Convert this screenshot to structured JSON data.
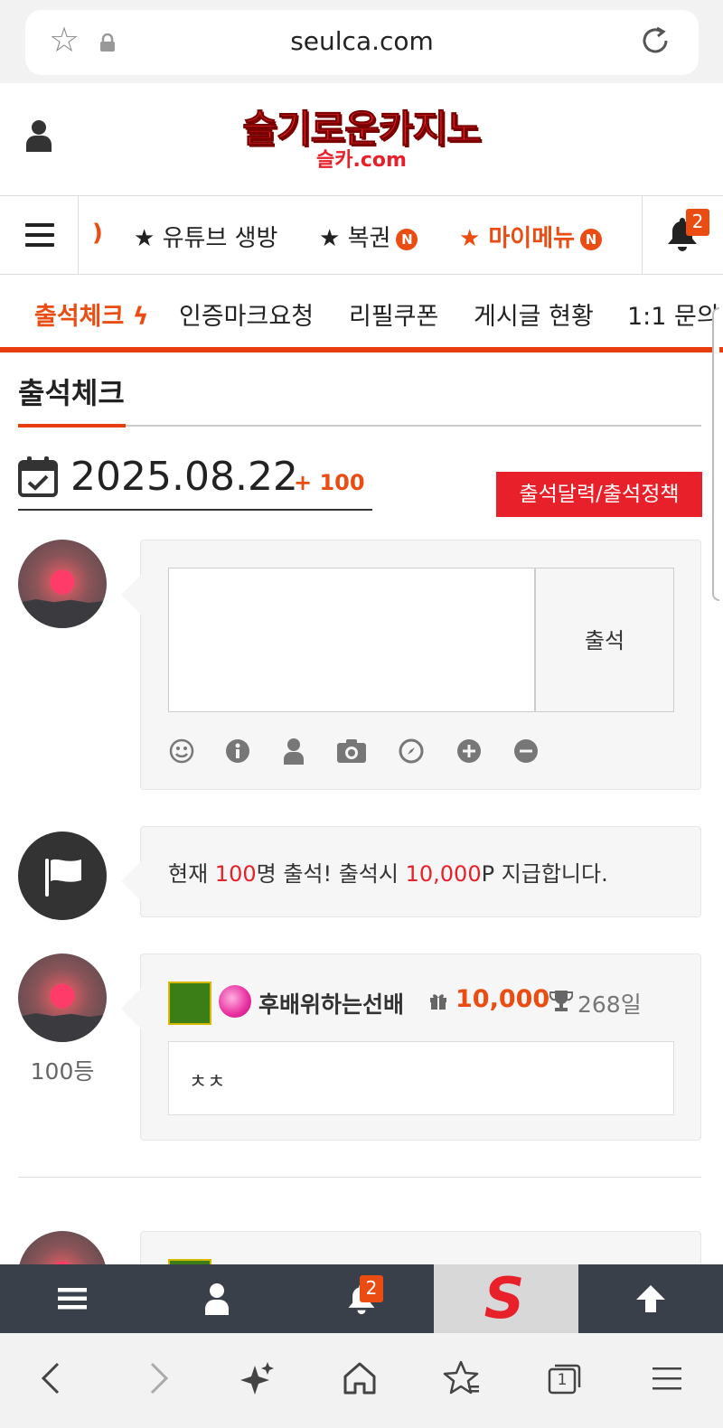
{
  "browser": {
    "url": "seulca.com",
    "tab_count": "1"
  },
  "header": {
    "logo_main": "슬기로운카지노",
    "logo_sub": "슬카.com"
  },
  "nav": {
    "items": [
      {
        "label": "★ 유튜브 생방"
      },
      {
        "label": "★ 복권",
        "badge": "N"
      },
      {
        "label": "★ 마이메뉴",
        "badge": "N"
      }
    ],
    "notification_count": "2"
  },
  "tabs": [
    {
      "label": "출석체크"
    },
    {
      "label": "인증마크요청"
    },
    {
      "label": "리필쿠폰"
    },
    {
      "label": "게시글 현황"
    },
    {
      "label": "1:1 문의"
    }
  ],
  "page": {
    "title": "출석체크",
    "date": "2025.08.22",
    "date_bonus": "+ 100",
    "policy_button": "출석달력/출석정책"
  },
  "attendance_form": {
    "comment_value": "",
    "submit_label": "출석",
    "toolbar_icons": [
      "smile-icon",
      "info-icon",
      "user-icon",
      "camera-icon",
      "compass-icon",
      "plus-circle-icon",
      "minus-circle-icon"
    ]
  },
  "notice": {
    "prefix": "현재 ",
    "count": "100",
    "middle": "명 출석! 출석시 ",
    "reward": "10,000",
    "suffix": "P 지급합니다."
  },
  "entries": [
    {
      "rank": "100등",
      "nickname": "후배위하는선배",
      "points": "10,000",
      "days": "268일",
      "comment": "ㅊㅊ"
    }
  ],
  "bottom_bar": {
    "notification_count": "2",
    "logo_letter": "S"
  },
  "colors": {
    "accent": "#ea4c12",
    "brand_red": "#e8202a",
    "dark_bar": "#3a4049"
  }
}
